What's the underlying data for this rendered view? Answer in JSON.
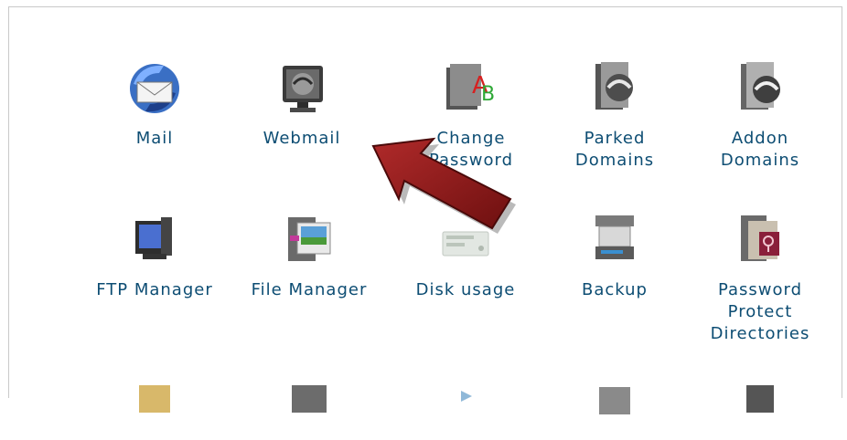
{
  "rows": [
    [
      {
        "label": "Mail",
        "icon": "mail-icon"
      },
      {
        "label": "Webmail",
        "icon": "webmail-icon"
      },
      {
        "label": "Change Password",
        "icon": "change-password-icon"
      },
      {
        "label": "Parked Domains",
        "icon": "parked-domains-icon"
      },
      {
        "label": "Addon Domains",
        "icon": "addon-domains-icon"
      }
    ],
    [
      {
        "label": "FTP Manager",
        "icon": "ftp-manager-icon"
      },
      {
        "label": "File Manager",
        "icon": "file-manager-icon"
      },
      {
        "label": "Disk usage",
        "icon": "disk-usage-icon"
      },
      {
        "label": "Backup",
        "icon": "backup-icon"
      },
      {
        "label": "Password Protect Directories",
        "icon": "password-protect-icon"
      }
    ]
  ],
  "annotation": {
    "icon": "red-arrow-icon",
    "color": "#8b1a1a"
  }
}
